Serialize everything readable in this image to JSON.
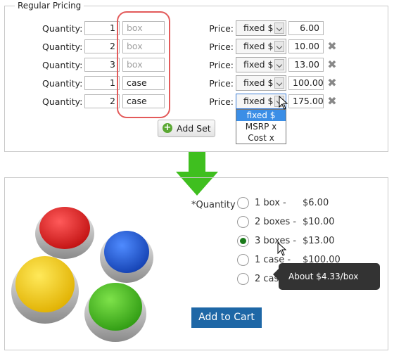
{
  "admin": {
    "legend": "Regular Pricing",
    "quantity_label": "Quantity:",
    "price_label": "Price:",
    "rows": [
      {
        "qty": "1",
        "unit": "",
        "unit_placeholder": "box",
        "price_type": "fixed $",
        "price": "6.00",
        "removable": false
      },
      {
        "qty": "2",
        "unit": "",
        "unit_placeholder": "box",
        "price_type": "fixed $",
        "price": "10.00",
        "removable": true
      },
      {
        "qty": "3",
        "unit": "",
        "unit_placeholder": "box",
        "price_type": "fixed $",
        "price": "13.00",
        "removable": true
      },
      {
        "qty": "1",
        "unit": "case",
        "unit_placeholder": "",
        "price_type": "fixed $",
        "price": "100.00",
        "removable": true
      },
      {
        "qty": "2",
        "unit": "case",
        "unit_placeholder": "",
        "price_type": "fixed $",
        "price": "175.00",
        "removable": true
      }
    ],
    "dropdown_options": [
      "fixed $",
      "MSRP x",
      "Cost x"
    ],
    "dropdown_selected": "fixed $",
    "add_set_label": "Add Set",
    "highlight_color": "#e35a5a",
    "delete_icon": "x-icon"
  },
  "arrow": {
    "color": "#3fbf1f",
    "icon": "down-arrow-icon"
  },
  "product": {
    "image": "colored-buttons-image",
    "quantity_label": "*Quantity",
    "options": [
      {
        "label": "1 box -",
        "price": "$6.00",
        "checked": false
      },
      {
        "label": "2 boxes -",
        "price": "$10.00",
        "checked": false
      },
      {
        "label": "3 boxes -",
        "price": "$13.00",
        "checked": true
      },
      {
        "label": "1 case -",
        "price": "$100.00",
        "checked": false
      },
      {
        "label": "2 cases -",
        "price": "",
        "checked": false
      }
    ],
    "tooltip": "About $4.33/box",
    "add_to_cart": "Add to Cart",
    "cart_color": "#1e67a6",
    "checked_color": "#1a7a1a"
  }
}
